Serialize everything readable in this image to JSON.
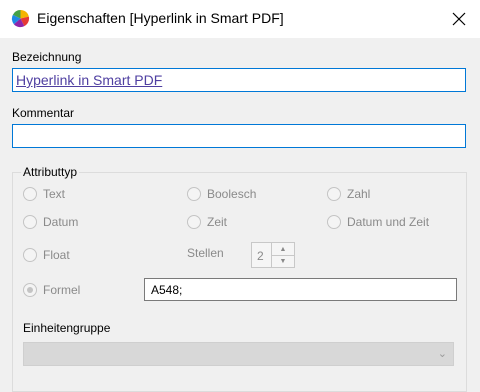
{
  "window": {
    "title": "Eigenschaften [Hyperlink in Smart PDF]",
    "app_icon": "colorful-globe-icon",
    "close_icon": "close-icon"
  },
  "form": {
    "bezeichnung_label": "Bezeichnung",
    "bezeichnung_value": "Hyperlink in Smart PDF",
    "kommentar_label": "Kommentar",
    "kommentar_value": ""
  },
  "attributtyp": {
    "legend": "Attributtyp",
    "options": [
      {
        "label": "Text",
        "selected": false
      },
      {
        "label": "Boolesch",
        "selected": false
      },
      {
        "label": "Zahl",
        "selected": false
      },
      {
        "label": "Datum",
        "selected": false
      },
      {
        "label": "Zeit",
        "selected": false
      },
      {
        "label": "Datum und Zeit",
        "selected": false
      },
      {
        "label": "Float",
        "selected": false
      },
      {
        "label": "Formel",
        "selected": true
      }
    ],
    "stellen_label": "Stellen",
    "stellen_value": "2",
    "formula_value": "A548;"
  },
  "einheitengruppe": {
    "label": "Einheitengruppe",
    "value": ""
  },
  "colors": {
    "accent": "#0078d7",
    "link": "#4f3fa1",
    "disabled_text": "#8a8a8a"
  }
}
